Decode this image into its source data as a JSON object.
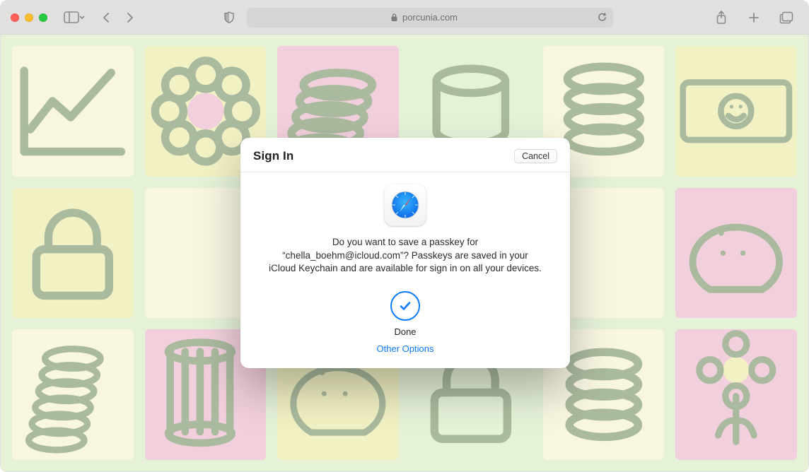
{
  "address_bar": {
    "url_display": "porcunia.com"
  },
  "sheet": {
    "title": "Sign In",
    "cancel_label": "Cancel",
    "prompt_text": "Do you want to save a passkey for “chella_boehm@icloud.com”? Passkeys are saved in your iCloud Keychain and are available for sign in on all your devices.",
    "done_label": "Done",
    "other_options_label": "Other Options"
  }
}
